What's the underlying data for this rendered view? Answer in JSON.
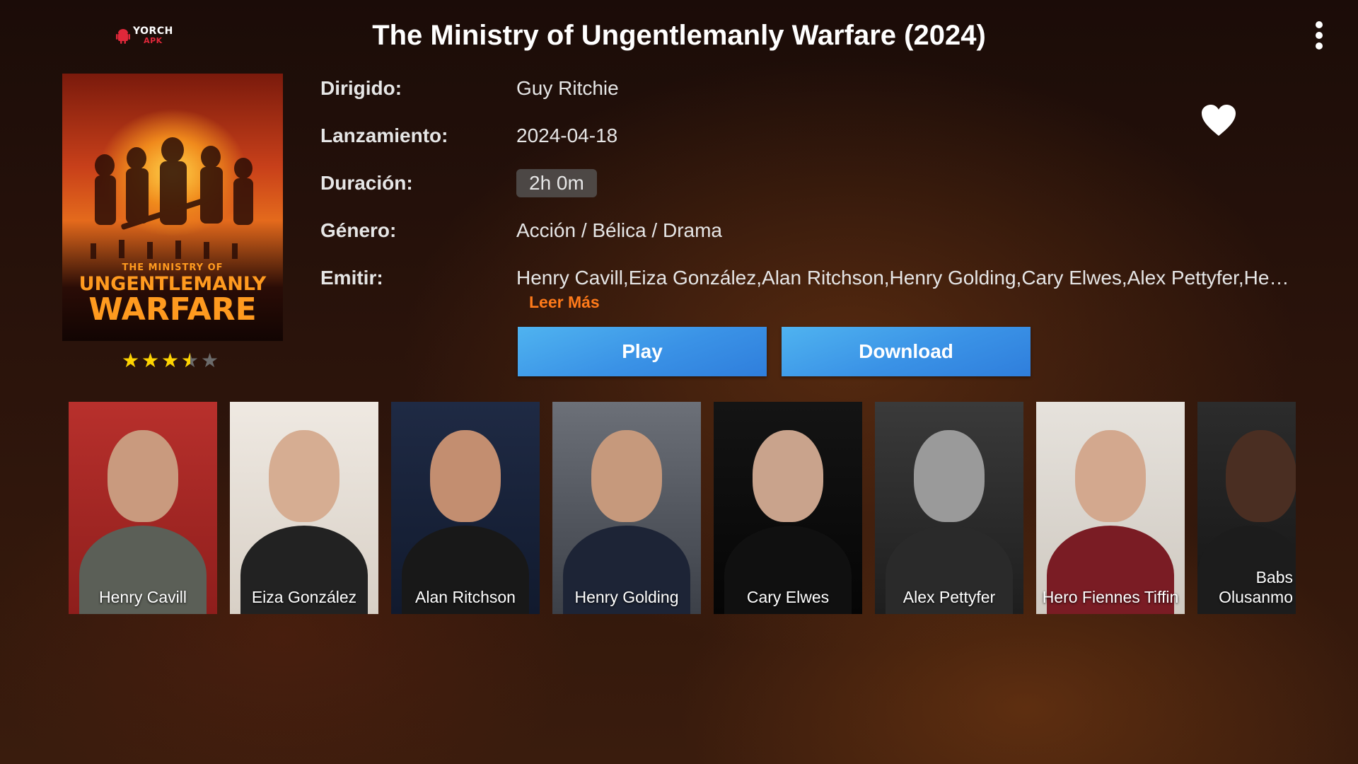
{
  "app": {
    "logo_text": "YORCH",
    "logo_sub": "APK"
  },
  "movie": {
    "title": "The Ministry of Ungentlemanly Warfare (2024)",
    "poster": {
      "line1": "THE MINISTRY OF",
      "line2": "UNGENTLEMANLY",
      "line3": "WARFARE"
    },
    "rating": {
      "stars_filled": 3.5,
      "stars_total": 5
    }
  },
  "details": {
    "director_label": "Dirigido:",
    "director": "Guy Ritchie",
    "release_label": "Lanzamiento:",
    "release": "2024-04-18",
    "duration_label": "Duración:",
    "duration": "2h 0m",
    "genre_label": "Género:",
    "genre": "Acción / Bélica / Drama",
    "cast_label": "Emitir:",
    "cast_text": "Henry Cavill,Eiza González,Alan Ritchson,Henry Golding,Cary Elwes,Alex Pettyfer,Hero Fi...",
    "read_more": "Leer Más"
  },
  "actions": {
    "play_label": "Play",
    "download_label": "Download"
  },
  "icons": {
    "more": "more-vertical-icon",
    "favorite": "heart-icon",
    "logo": "android-icon"
  },
  "cast": [
    {
      "name": "Henry Cavill"
    },
    {
      "name": "Eiza González"
    },
    {
      "name": "Alan Ritchson"
    },
    {
      "name": "Henry Golding"
    },
    {
      "name": "Cary Elwes"
    },
    {
      "name": "Alex Pettyfer"
    },
    {
      "name": "Hero Fiennes Tiffin"
    },
    {
      "name": "Babs Olusanmokun",
      "display_line1": "Babs",
      "display_line2": "Olusanmo"
    }
  ],
  "colors": {
    "accent": "#ff7a1a",
    "button": "#3a92e6",
    "star": "#ffd400"
  }
}
